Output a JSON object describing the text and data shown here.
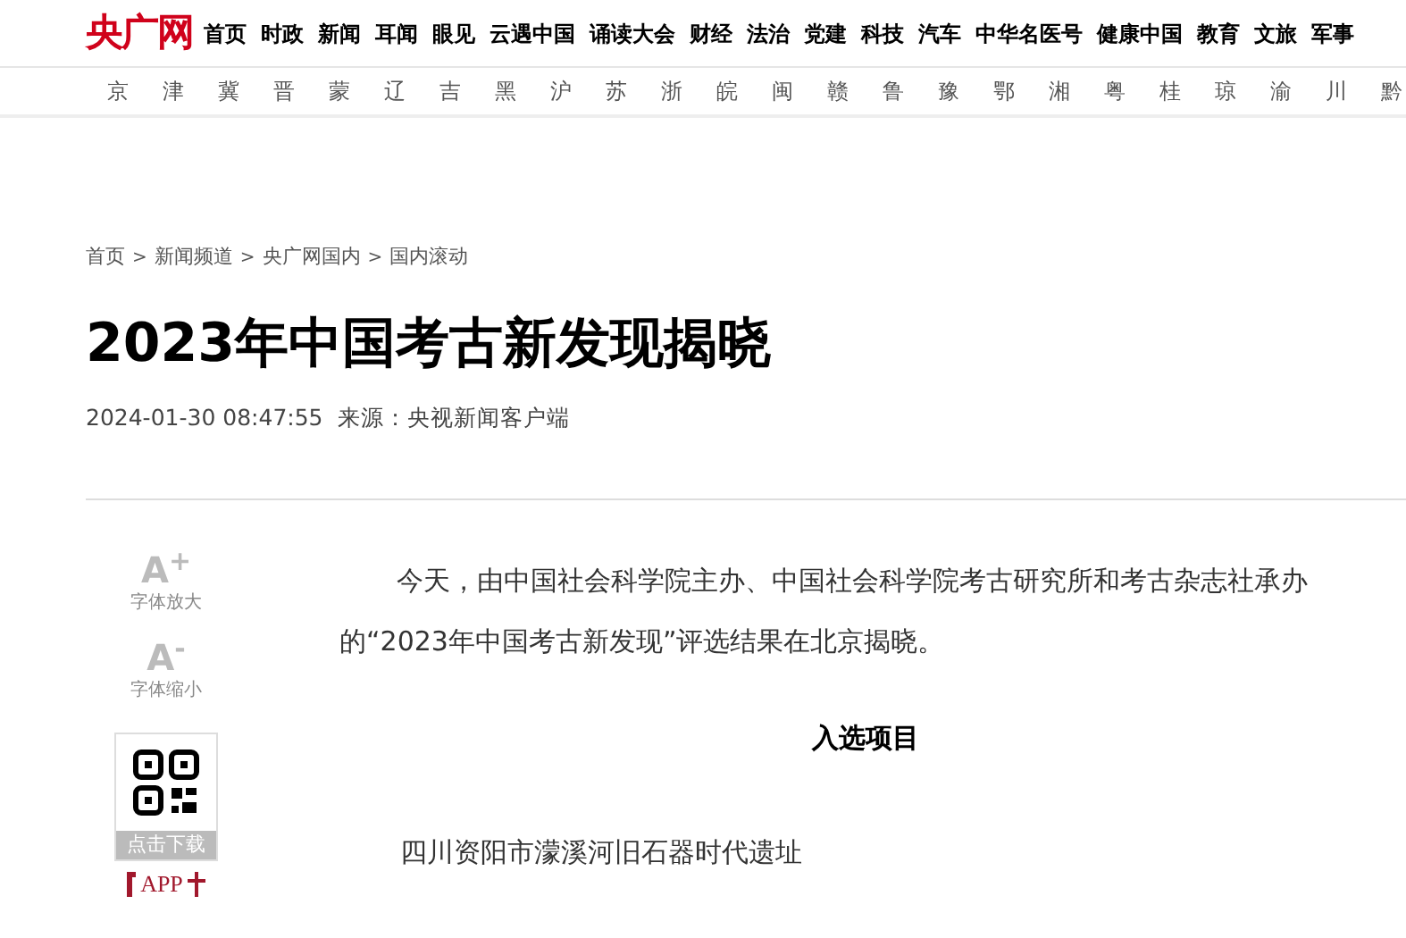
{
  "header": {
    "logo": "央广网",
    "nav": [
      "首页",
      "时政",
      "新闻",
      "耳闻",
      "眼见",
      "云遇中国",
      "诵读大会",
      "财经",
      "法治",
      "党建",
      "科技",
      "汽车",
      "中华名医号",
      "健康中国",
      "教育",
      "文旅",
      "军事"
    ]
  },
  "regions": [
    "京",
    "津",
    "冀",
    "晋",
    "蒙",
    "辽",
    "吉",
    "黑",
    "沪",
    "苏",
    "浙",
    "皖",
    "闽",
    "赣",
    "鲁",
    "豫",
    "鄂",
    "湘",
    "粤",
    "桂",
    "琼",
    "渝",
    "川",
    "黔"
  ],
  "breadcrumb": [
    "首页",
    "新闻频道",
    "央广网国内",
    "国内滚动"
  ],
  "breadcrumb_separator": ">",
  "article": {
    "title": "2023年中国考古新发现揭晓",
    "date": "2024-01-30 08:47:55",
    "source": "来源：央视新闻客户端",
    "paragraphs": [
      {
        "kind": "paragraph",
        "text": "今天，由中国社会科学院主办、中国社会科学院考古研究所和考古杂志社承办的“2023年中国考古新发现”评选结果在北京揭晓。"
      },
      {
        "kind": "heading",
        "text": "入选项目"
      },
      {
        "kind": "item",
        "text": "四川资阳市濛溪河旧石器时代遗址"
      }
    ]
  },
  "tools": [
    {
      "icon": "A$^{+}$",
      "label": "字体放大"
    },
    {
      "icon": "A$^{-}$",
      "label": "字体缩小"
    }
  ],
  "download": {
    "label": "点击下载",
    "app": "APP"
  }
}
